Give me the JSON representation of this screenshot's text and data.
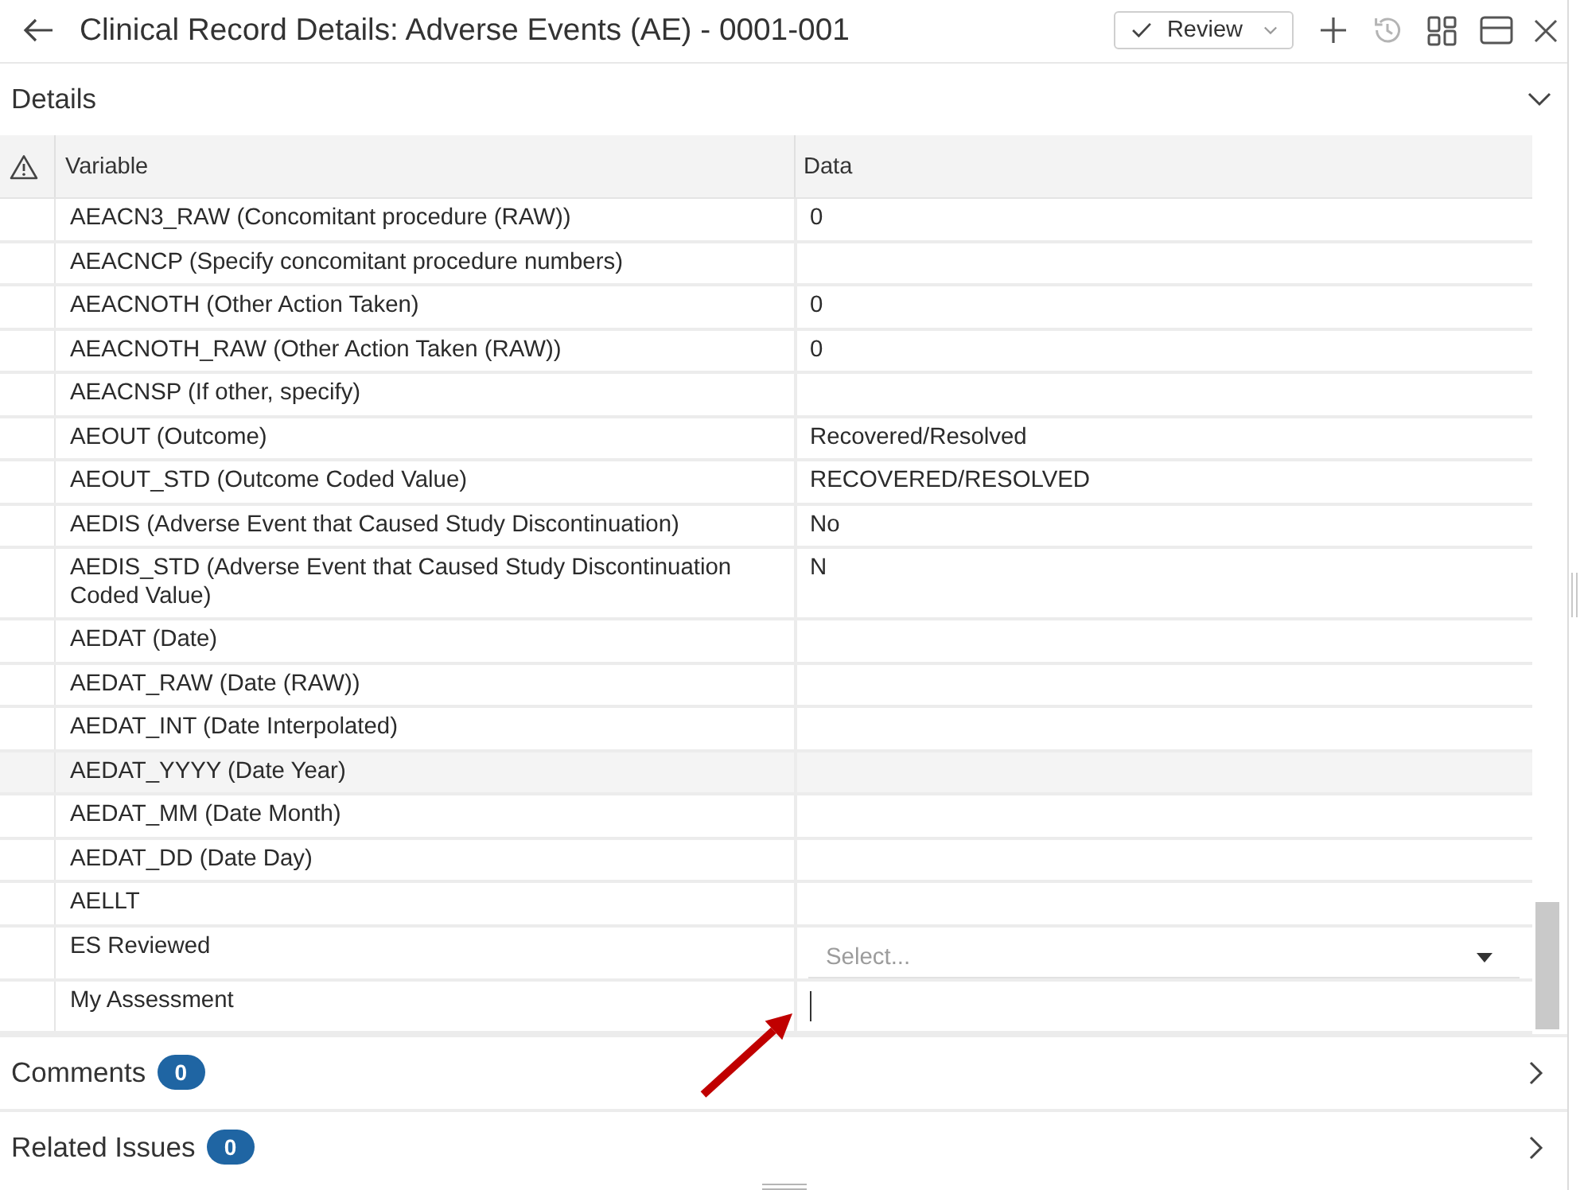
{
  "window": {
    "title": "Clinical Record Details: Adverse Events (AE) - 0001-001"
  },
  "toolbar": {
    "review_button": {
      "label": "Review"
    },
    "buttons": [
      {
        "kind": "add",
        "disabled": false
      },
      {
        "kind": "history",
        "disabled": true
      },
      {
        "kind": "grid",
        "disabled": false
      },
      {
        "kind": "panel",
        "disabled": false
      },
      {
        "kind": "close",
        "disabled": false
      }
    ]
  },
  "details": {
    "title": "Details",
    "expanded": true,
    "table": {
      "columns": [
        "Variable",
        "Data"
      ],
      "rows": [
        {
          "variable": "AEACN3_RAW (Concomitant procedure (RAW))",
          "kind": "text",
          "value": "0",
          "highlighted": false
        },
        {
          "variable": "AEACNCP (Specify concomitant procedure numbers)",
          "kind": "text",
          "highlighted": false
        },
        {
          "variable": "AEACNOTH (Other Action Taken)",
          "kind": "text",
          "value": "0",
          "highlighted": false
        },
        {
          "variable": "AEACNOTH_RAW (Other Action Taken (RAW))",
          "kind": "text",
          "value": "0",
          "highlighted": false
        },
        {
          "variable": "AEACNSP (If other, specify)",
          "kind": "text",
          "highlighted": false
        },
        {
          "variable": "AEOUT (Outcome)",
          "kind": "text",
          "value": "Recovered/Resolved",
          "highlighted": false
        },
        {
          "variable": "AEOUT_STD (Outcome Coded Value)",
          "kind": "text",
          "value": "RECOVERED/RESOLVED",
          "highlighted": false
        },
        {
          "variable": "AEDIS (Adverse Event that Caused Study Discontinuation)",
          "kind": "text",
          "value": "No",
          "highlighted": false
        },
        {
          "variable": "AEDIS_STD (Adverse Event that Caused Study Discontinuation Coded Value)",
          "kind": "text",
          "value": "N",
          "highlighted": false
        },
        {
          "variable": "AEDAT (Date)",
          "kind": "text",
          "highlighted": false
        },
        {
          "variable": "AEDAT_RAW (Date (RAW))",
          "kind": "text",
          "highlighted": false
        },
        {
          "variable": "AEDAT_INT (Date Interpolated)",
          "kind": "text",
          "highlighted": false
        },
        {
          "variable": "AEDAT_YYYY (Date Year)",
          "kind": "text",
          "highlighted": true
        },
        {
          "variable": "AEDAT_MM (Date Month)",
          "kind": "text",
          "highlighted": false
        },
        {
          "variable": "AEDAT_DD (Date Day)",
          "kind": "text",
          "highlighted": false
        },
        {
          "variable": "AELLT",
          "kind": "text",
          "highlighted": false
        },
        {
          "variable": "ES Reviewed",
          "kind": "select",
          "placeholder": "Select...",
          "highlighted": false
        },
        {
          "variable": "My Assessment",
          "kind": "input",
          "focused": true,
          "highlighted": false
        }
      ]
    }
  },
  "sections": [
    {
      "title": "Comments",
      "count": "0",
      "expanded": false
    },
    {
      "title": "Related Issues",
      "count": "0",
      "expanded": false
    }
  ],
  "annotation": {
    "kind": "arrow"
  }
}
